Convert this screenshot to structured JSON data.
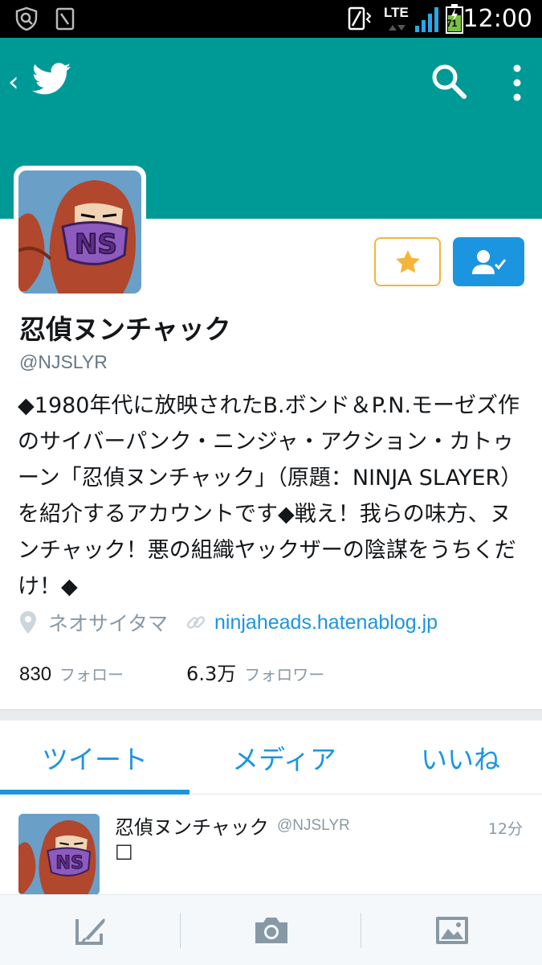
{
  "status_bar": {
    "time": "12:00",
    "network": "LTE",
    "battery": "71",
    "icons": [
      "shield-search-icon",
      "sd-card-icon",
      "vibrate-icon",
      "signal-icon",
      "battery-icon"
    ]
  },
  "header": {
    "icons": [
      "back-chevron-icon",
      "twitter-bird-icon",
      "search-icon",
      "overflow-menu-icon"
    ],
    "background_color": "#009a96"
  },
  "profile": {
    "display_name": "忍偵ヌンチャック",
    "handle": "@NJSLYR",
    "bio": "◆1980年代に放映されたB.ボンド＆P.N.モーゼズ作のサイバーパンク・ニンジャ・アクション・カトゥーン「忍偵ヌンチャック」（原題：NINJA SLAYER）を紹介するアカウントです◆戦え！我らの味方、ヌンチャック！悪の組織ヤックザーの陰謀をうちくだけ！◆",
    "location": "ネオサイタマ",
    "url": "ninjaheads.hatenablog.jp",
    "following_count": "830",
    "following_label": "フォロー",
    "followers_count": "6.3万",
    "followers_label": "フォロワー"
  },
  "actions": {
    "favorite_icon": "star-icon",
    "follow_icon": "user-check-icon",
    "accent_star": "#f5b53a",
    "accent_blue": "#1b95e0"
  },
  "tabs": [
    {
      "label": "ツイート",
      "selected": true
    },
    {
      "label": "メディア",
      "selected": false
    },
    {
      "label": "いいね",
      "selected": false
    }
  ],
  "tweet": {
    "name": "忍偵ヌンチャック",
    "handle": "@NJSLYR",
    "time": "12分",
    "text": "□"
  },
  "bottom_bar": {
    "icons": [
      "compose-icon",
      "camera-icon",
      "image-icon"
    ]
  }
}
